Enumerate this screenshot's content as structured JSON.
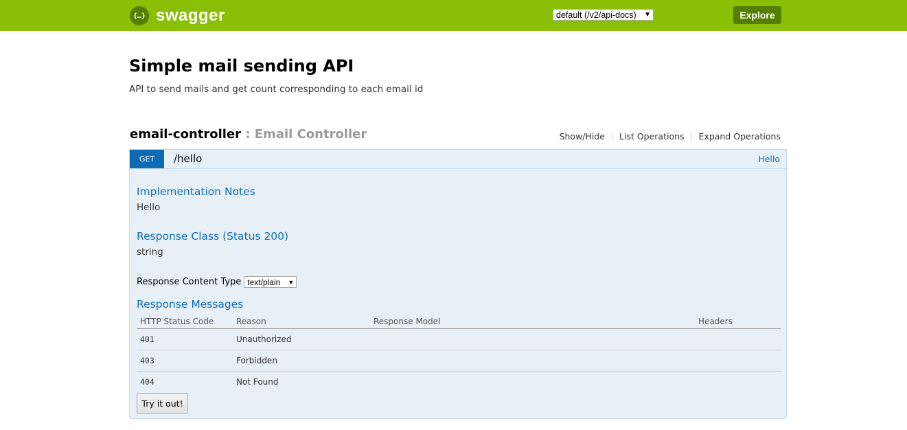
{
  "header": {
    "logo_glyph": "{…}",
    "logo_text": "swagger",
    "spec_selector": "default (/v2/api-docs)",
    "explore_label": "Explore",
    "colors": {
      "bar": "#89bf04",
      "button": "#547f00"
    }
  },
  "info": {
    "title": "Simple mail sending API",
    "description": "API to send mails and get count corresponding to each email id"
  },
  "resource": {
    "name": "email-controller",
    "separator": " : ",
    "description": "Email Controller",
    "links": [
      "Show/Hide",
      "List Operations",
      "Expand Operations"
    ]
  },
  "operation": {
    "method": "GET",
    "path": "/hello",
    "summary": "Hello",
    "method_color": "#0f6ab4",
    "implementation_notes_title": "Implementation Notes",
    "implementation_notes": "Hello",
    "response_class_title": "Response Class (Status 200)",
    "response_class": "string",
    "response_content_type_label": "Response Content Type",
    "response_content_type": "text/plain",
    "response_messages_title": "Response Messages",
    "columns": [
      "HTTP Status Code",
      "Reason",
      "Response Model",
      "Headers"
    ],
    "messages": [
      {
        "code": "401",
        "reason": "Unauthorized"
      },
      {
        "code": "403",
        "reason": "Forbidden"
      },
      {
        "code": "404",
        "reason": "Not Found"
      }
    ],
    "try_label": "Try it out!"
  }
}
